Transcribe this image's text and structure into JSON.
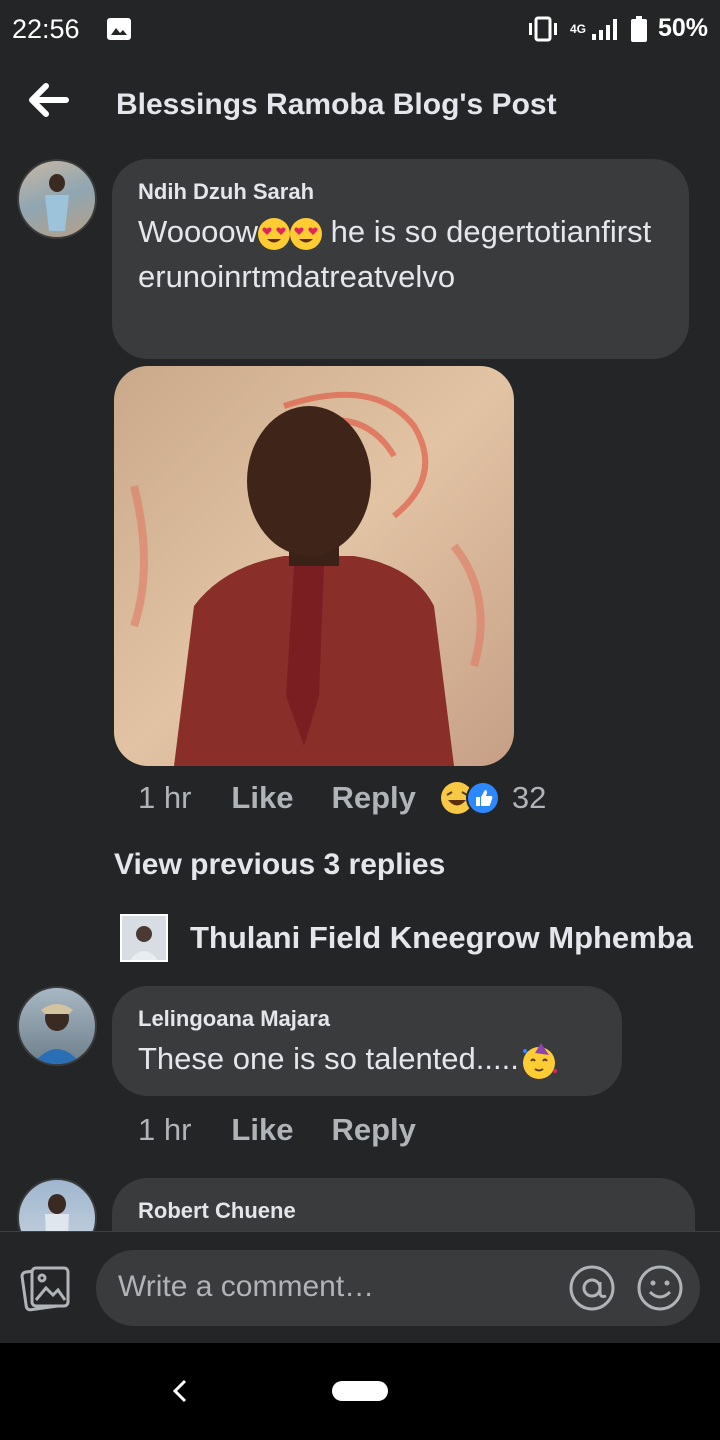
{
  "status_bar": {
    "time": "22:56",
    "network": "4G",
    "battery": "50%"
  },
  "header": {
    "title": "Blessings Ramoba Blog's Post"
  },
  "comments": [
    {
      "author": "Ndih Dzuh Sarah",
      "text_before": "Woooow",
      "text_after": " he is so degertotianfirsterunoinrtmdatreatvelvo",
      "time": "1 hr",
      "like": "Like",
      "reply": "Reply",
      "reaction_count": "32",
      "reactions": [
        "haha",
        "like"
      ]
    },
    {
      "author": "Lelingoana Majara",
      "text": "These one is so talented.....",
      "time": "1 hr",
      "like": "Like",
      "reply": "Reply"
    },
    {
      "author": "Robert Chuene"
    }
  ],
  "view_previous": "View previous 3 replies",
  "reply_author": "Thulani Field Kneegrow Mphemba",
  "composer": {
    "placeholder": "Write a comment…"
  },
  "colors": {
    "background": "#242526",
    "bubble": "#3a3b3c",
    "text": "#e4e6eb",
    "muted": "#b0b3b8"
  }
}
